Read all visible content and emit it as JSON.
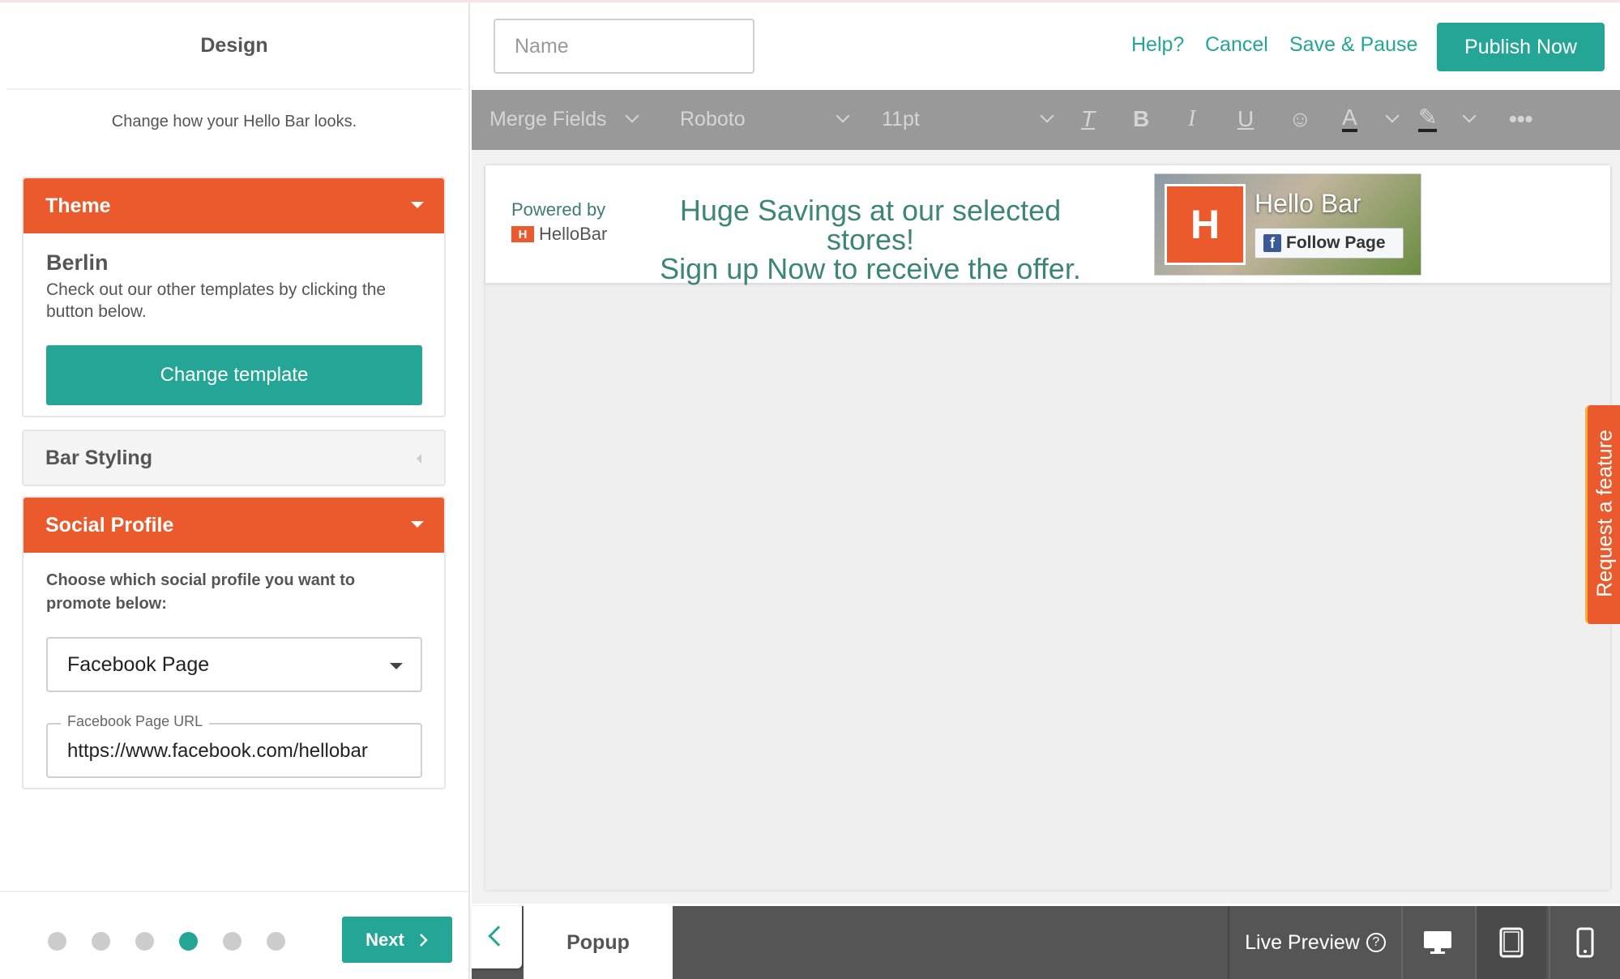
{
  "sidebar": {
    "title": "Design",
    "subtitle": "Change how your Hello Bar looks.",
    "theme": {
      "header": "Theme",
      "name": "Berlin",
      "description": "Check out our other templates by clicking the button below.",
      "button": "Change template"
    },
    "bar_styling": {
      "header": "Bar Styling"
    },
    "social_profile": {
      "header": "Social Profile",
      "description": "Choose which social profile you want to promote below:",
      "select_value": "Facebook Page",
      "url_label": "Facebook Page URL",
      "url_value": "https://www.facebook.com/hellobar"
    },
    "footer": {
      "steps_total": 6,
      "active_step": 4,
      "next_label": "Next"
    }
  },
  "topbar": {
    "name_placeholder": "Name",
    "help": "Help?",
    "cancel": "Cancel",
    "save_pause": "Save & Pause",
    "publish": "Publish Now"
  },
  "toolbar": {
    "merge_fields": "Merge Fields",
    "font": "Roboto",
    "size": "11pt"
  },
  "preview": {
    "powered_by": "Powered by",
    "brand": "HelloBar",
    "headline_1": "Huge Savings at our selected stores!",
    "headline_2": "Sign up Now to receive the offer.",
    "fb_title": "Hello Bar",
    "fb_follow": "Follow Page"
  },
  "request_feature": "Request a feature",
  "bottombar": {
    "popup": "Popup",
    "live_preview": "Live Preview"
  },
  "colors": {
    "accent": "#24a596",
    "orange": "#ea5a2d",
    "toolbar": "#999999",
    "bottom": "#555555"
  }
}
